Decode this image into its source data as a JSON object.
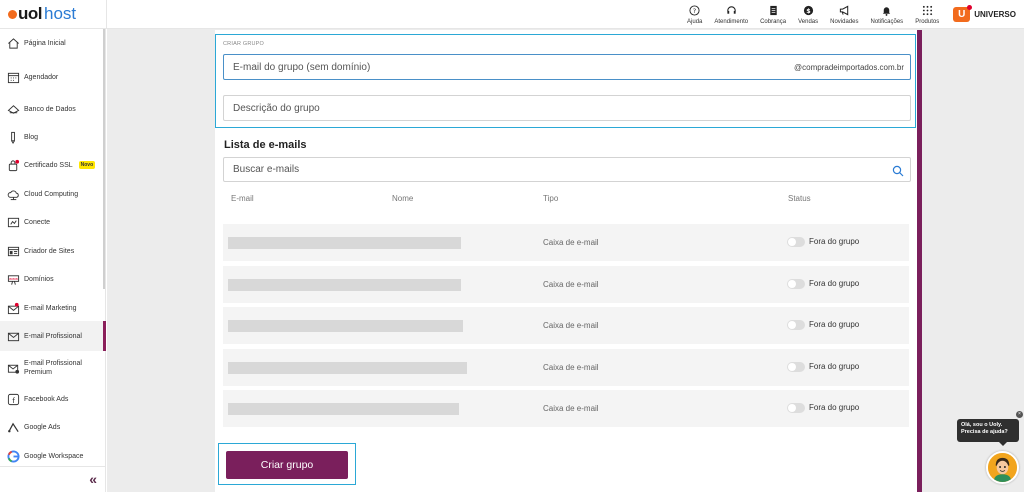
{
  "brand": {
    "name_bold": "uol",
    "name_light": "host",
    "accent": "#7a1f5c",
    "focus": "#2ba8d6"
  },
  "topnav": [
    {
      "label": "Ajuda",
      "icon": "help-icon"
    },
    {
      "label": "Atendimento",
      "icon": "headset-icon"
    },
    {
      "label": "Cobrança",
      "icon": "invoice-icon"
    },
    {
      "label": "Vendas",
      "icon": "money-icon"
    },
    {
      "label": "Novidades",
      "icon": "megaphone-icon"
    },
    {
      "label": "Notificações",
      "icon": "bell-icon"
    },
    {
      "label": "Produtos",
      "icon": "grid-icon"
    }
  ],
  "universo": {
    "badge": "U",
    "label": "UNIVERSO"
  },
  "sidebar": {
    "items": [
      {
        "label": "Página Inicial",
        "icon": "home-icon"
      },
      {
        "label": "Agendador",
        "icon": "calendar-icon"
      },
      {
        "label": "Banco de Dados",
        "icon": "database-icon"
      },
      {
        "label": "Blog",
        "icon": "pen-icon"
      },
      {
        "label": "Certificado SSL",
        "icon": "certificate-icon",
        "badge": "Novo"
      },
      {
        "label": "Cloud Computing",
        "icon": "cloud-icon"
      },
      {
        "label": "Conecte",
        "icon": "connect-icon"
      },
      {
        "label": "Criador de Sites",
        "icon": "site-builder-icon"
      },
      {
        "label": "Domínios",
        "icon": "domain-icon"
      },
      {
        "label": "E-mail Marketing",
        "icon": "email-marketing-icon"
      },
      {
        "label": "E-mail Profissional",
        "icon": "envelope-icon",
        "active": true
      },
      {
        "label": "E-mail Profissional",
        "label2": "Premium",
        "icon": "envelope-premium-icon"
      },
      {
        "label": "Facebook Ads",
        "icon": "facebook-ads-icon"
      },
      {
        "label": "Google Ads",
        "icon": "google-ads-icon"
      },
      {
        "label": "Google Workspace",
        "icon": "google-icon"
      }
    ],
    "collapse_glyph": "«"
  },
  "group_form": {
    "section_title": "CRIAR GRUPO",
    "email_placeholder": "E-mail do grupo (sem domínio)",
    "email_suffix": "@compradeimportados.com.br",
    "description_placeholder": "Descrição do grupo"
  },
  "email_list": {
    "title": "Lista de e-mails",
    "search_placeholder": "Buscar e-mails",
    "columns": [
      "E-mail",
      "Nome",
      "Tipo",
      "Status"
    ],
    "rows": [
      {
        "type": "Caixa de e-mail",
        "status": "Fora do grupo",
        "enabled": false
      },
      {
        "type": "Caixa de e-mail",
        "status": "Fora do grupo",
        "enabled": false
      },
      {
        "type": "Caixa de e-mail",
        "status": "Fora do grupo",
        "enabled": false
      },
      {
        "type": "Caixa de e-mail",
        "status": "Fora do grupo",
        "enabled": false
      },
      {
        "type": "Caixa de e-mail",
        "status": "Fora do grupo",
        "enabled": false
      }
    ]
  },
  "create_button": "Criar grupo",
  "chat": {
    "line1": "Olá, sou o Uoly.",
    "line2": "Precisa de ajuda?",
    "close": "×"
  }
}
